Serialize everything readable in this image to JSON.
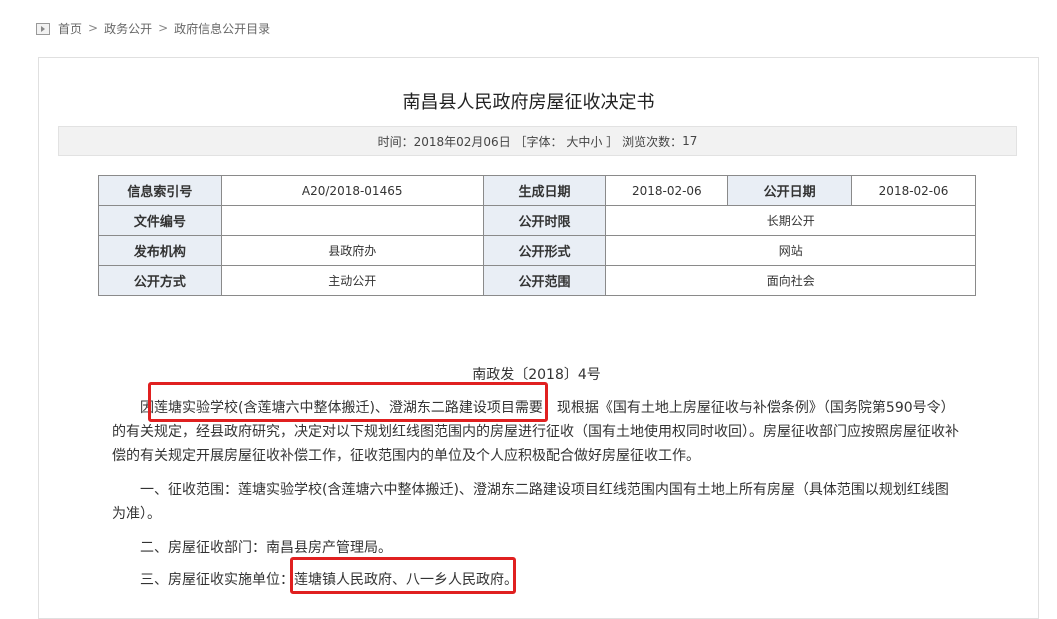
{
  "breadcrumb": {
    "home": "首页",
    "sep": ">",
    "level2": "政务公开",
    "level3": "政府信息公开目录"
  },
  "article": {
    "title": "南昌县人民政府房屋征收决定书",
    "meta": {
      "time_label": "时间：",
      "time_value": "2018年02月06日",
      "font_label": "［字体：",
      "font_big": "大",
      "font_mid": "中",
      "font_small": "小",
      "font_close": "］",
      "views_label": "浏览次数：",
      "views_value": "17"
    },
    "info_table": [
      {
        "l1": "信息索引号",
        "v1": "A20/2018-01465",
        "l2": "生成日期",
        "v2": "2018-02-06",
        "l3": "公开日期",
        "v3": "2018-02-06"
      },
      {
        "l1": "文件编号",
        "v1": "",
        "l2": "公开时限",
        "v2": "长期公开"
      },
      {
        "l1": "发布机构",
        "v1": "县政府办",
        "l2": "公开形式",
        "v2": "网站"
      },
      {
        "l1": "公开方式",
        "v1": "主动公开",
        "l2": "公开范围",
        "v2": "面向社会"
      }
    ],
    "doc_number": "南政发〔2018〕4号",
    "paragraphs": [
      "因莲塘实验学校(含莲塘六中整体搬迁)、澄湖东二路建设项目需要，现根据《国有土地上房屋征收与补偿条例》（国务院第590号令）的有关规定，经县政府研究，决定对以下规划红线图范围内的房屋进行征收（国有土地使用权同时收回）。房屋征收部门应按照房屋征收补偿的有关规定开展房屋征收补偿工作，征收范围内的单位及个人应积极配合做好房屋征收工作。",
      "一、征收范围：莲塘实验学校(含莲塘六中整体搬迁)、澄湖东二路建设项目红线范围内国有土地上所有房屋（具体范围以规划红线图为准）。",
      "二、房屋征收部门：南昌县房产管理局。",
      "三、房屋征收实施单位：莲塘镇人民政府、八一乡人民政府。"
    ]
  },
  "annotations": {
    "color": "#e02020"
  }
}
